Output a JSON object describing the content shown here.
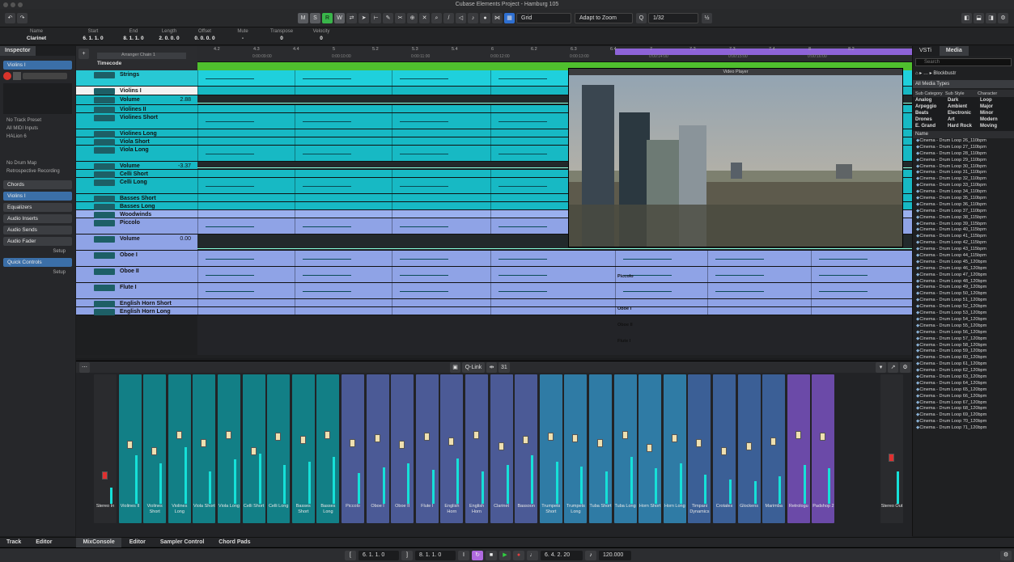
{
  "window": {
    "title": "Cubase Elements Project - Hamburg 105"
  },
  "toolbar": {
    "buttons": [
      "M",
      "S",
      "R",
      "W"
    ],
    "grid_label": "Grid",
    "zoom_label": "Adapt to Zoom",
    "quantize": "1/32"
  },
  "info_line": [
    {
      "label": "Name",
      "value": "Clarinet"
    },
    {
      "label": "Start",
      "value": "6. 1. 1.  0"
    },
    {
      "label": "End",
      "value": "8. 1. 1.  0"
    },
    {
      "label": "Length",
      "value": "2. 0. 0.  0"
    },
    {
      "label": "Offset",
      "value": "0. 0. 0.  0"
    },
    {
      "label": "Mute",
      "value": "-"
    },
    {
      "label": "Transpose",
      "value": "0"
    },
    {
      "label": "Velocity",
      "value": "0"
    }
  ],
  "inspector": {
    "tab": "Inspector",
    "track_name": "Violins I",
    "no_track_preset": "No Track Preset",
    "midi_input": "All MIDI Inputs",
    "output": "HALion 6",
    "drum_map": "No Drum Map",
    "retro": "Retrospective Recording",
    "sections": [
      "Chords",
      "Violins I",
      "Equalizers",
      "Audio Inserts",
      "Audio Sends",
      "Audio Fader",
      "Quick Controls"
    ],
    "setup": "Setup"
  },
  "ruler": {
    "timecode_label": "Timecode",
    "arranger_label": "Arranger Chain 1",
    "bars": [
      "4.2",
      "4.3",
      "4.4",
      "5",
      "5.2",
      "5.3",
      "5.4",
      "6",
      "6.2",
      "6.3",
      "6.4",
      "7",
      "7.2",
      "7.3",
      "7.4",
      "8",
      "8.2"
    ],
    "times": [
      "0:00:09:00",
      "0:00:10:00",
      "0:00:11:00",
      "0:00:12:00",
      "0:00:13:00",
      "0:00:14:00",
      "0:00:15:00",
      "0:00:16:00"
    ]
  },
  "tracks": [
    {
      "name": "Strings",
      "kind": "folder",
      "h": 20
    },
    {
      "name": "Violins I",
      "kind": "selected",
      "h": 11
    },
    {
      "name": "Volume",
      "kind": "auto",
      "h": 12,
      "value": "2.88"
    },
    {
      "name": "Violines II",
      "kind": "cyan",
      "h": 10
    },
    {
      "name": "Violines Short",
      "kind": "cyan",
      "h": 20
    },
    {
      "name": "Violines Long",
      "kind": "cyan",
      "h": 10
    },
    {
      "name": "Viola Short",
      "kind": "cyan",
      "h": 10
    },
    {
      "name": "Viola Long",
      "kind": "cyan",
      "h": 20
    },
    {
      "name": "Volume",
      "kind": "auto",
      "h": 10,
      "value": "-3.37"
    },
    {
      "name": "Celli Short",
      "kind": "cyan",
      "h": 10
    },
    {
      "name": "Celli Long",
      "kind": "cyan",
      "h": 20
    },
    {
      "name": "Basses Short",
      "kind": "cyan",
      "h": 10
    },
    {
      "name": "Basses Long",
      "kind": "cyan",
      "h": 10
    },
    {
      "name": "Woodwinds",
      "kind": "folder2",
      "h": 10
    },
    {
      "name": "Piccolo",
      "kind": "violet",
      "h": 20
    },
    {
      "name": "Volume",
      "kind": "auto2",
      "h": 20,
      "value": "0.00"
    },
    {
      "name": "Oboe I",
      "kind": "violet",
      "h": 20
    },
    {
      "name": "Oboe II",
      "kind": "violet",
      "h": 20
    },
    {
      "name": "Flute I",
      "kind": "violet",
      "h": 20
    },
    {
      "name": "English Horn Short",
      "kind": "violet",
      "h": 10
    },
    {
      "name": "English Horn Long",
      "kind": "violet",
      "h": 10
    }
  ],
  "part_labels": [
    "Strings",
    "Violins I",
    "Celli Long",
    "Piccolo",
    "Piccolo",
    "Oboe I",
    "Oboe I",
    "Oboe II",
    "Oboe II",
    "Flute I",
    "Flute I"
  ],
  "video": {
    "title": "Video Player"
  },
  "right_zone": {
    "tabs": [
      "VSTi",
      "Media"
    ],
    "search_placeholder": "Search",
    "path": "Blockbustr",
    "filter": "All Media Types",
    "columns": [
      "Sub Category",
      "Sub Style",
      "Character"
    ],
    "categories": [
      "Analog",
      "Arpeggio",
      "Beats",
      "Drones",
      "E. Grand"
    ],
    "styles": [
      "Dark Ambient",
      "Electronic Art",
      "Hard Rock"
    ],
    "characters": [
      "Loop",
      "Major",
      "Minor",
      "Modern",
      "Moving"
    ],
    "name_header": "Name",
    "loops": [
      "Cinema - Drum Loop 26_110bpm",
      "Cinema - Drum Loop 27_110bpm",
      "Cinema - Drum Loop 28_110bpm",
      "Cinema - Drum Loop 29_110bpm",
      "Cinema - Drum Loop 30_110bpm",
      "Cinema - Drum Loop 31_110bpm",
      "Cinema - Drum Loop 32_110bpm",
      "Cinema - Drum Loop 33_110bpm",
      "Cinema - Drum Loop 34_110bpm",
      "Cinema - Drum Loop 35_110bpm",
      "Cinema - Drum Loop 36_110bpm",
      "Cinema - Drum Loop 37_110bpm",
      "Cinema - Drum Loop 38_115bpm",
      "Cinema - Drum Loop 39_115bpm",
      "Cinema - Drum Loop 40_115bpm",
      "Cinema - Drum Loop 41_115bpm",
      "Cinema - Drum Loop 42_115bpm",
      "Cinema - Drum Loop 43_115bpm",
      "Cinema - Drum Loop 44_115bpm",
      "Cinema - Drum Loop 45_120bpm",
      "Cinema - Drum Loop 46_120bpm",
      "Cinema - Drum Loop 47_120bpm",
      "Cinema - Drum Loop 48_120bpm",
      "Cinema - Drum Loop 49_120bpm",
      "Cinema - Drum Loop 50_120bpm",
      "Cinema - Drum Loop 51_120bpm",
      "Cinema - Drum Loop 52_120bpm",
      "Cinema - Drum Loop 53_120bpm",
      "Cinema - Drum Loop 54_120bpm",
      "Cinema - Drum Loop 55_120bpm",
      "Cinema - Drum Loop 56_120bpm",
      "Cinema - Drum Loop 57_120bpm",
      "Cinema - Drum Loop 58_120bpm",
      "Cinema - Drum Loop 59_120bpm",
      "Cinema - Drum Loop 60_120bpm",
      "Cinema - Drum Loop 61_120bpm",
      "Cinema - Drum Loop 62_120bpm",
      "Cinema - Drum Loop 63_120bpm",
      "Cinema - Drum Loop 64_120bpm",
      "Cinema - Drum Loop 65_120bpm",
      "Cinema - Drum Loop 66_120bpm",
      "Cinema - Drum Loop 67_120bpm",
      "Cinema - Drum Loop 68_120bpm",
      "Cinema - Drum Loop 69_120bpm",
      "Cinema - Drum Loop 70_120bpm",
      "Cinema - Drum Loop 71_120bpm"
    ]
  },
  "mixer": {
    "qlink": "Q-Link",
    "count": "31",
    "channels": [
      "Stereo In",
      "Violines II",
      "Violines Short",
      "Violines Long",
      "Viola Short",
      "Viola Long",
      "Celli Short",
      "Celli Long",
      "Basses Short",
      "Basses Long",
      "Piccolo",
      "Oboe I",
      "Oboe II",
      "Flute I",
      "English Horn",
      "English Horn",
      "Clarinet",
      "Bassoon",
      "Trumpets Short",
      "Trumpets Long",
      "Tuba Short",
      "Tuba Long",
      "Horn Short",
      "Horn Long",
      "Timpani Dynamics",
      "Crotales",
      "Glockens",
      "Marimba",
      "Retrologu",
      "Padshop 2",
      "Stereo Out"
    ]
  },
  "bottom_tabs": {
    "left": [
      "Track",
      "Editor"
    ],
    "main": [
      "MixConsole",
      "Editor",
      "Sampler Control",
      "Chord Pads"
    ]
  },
  "transport": {
    "left_locator": "6. 1. 1.  0",
    "right_locator": "8. 1. 1.  0",
    "position": "6. 4. 2. 20",
    "tempo": "120.000"
  }
}
